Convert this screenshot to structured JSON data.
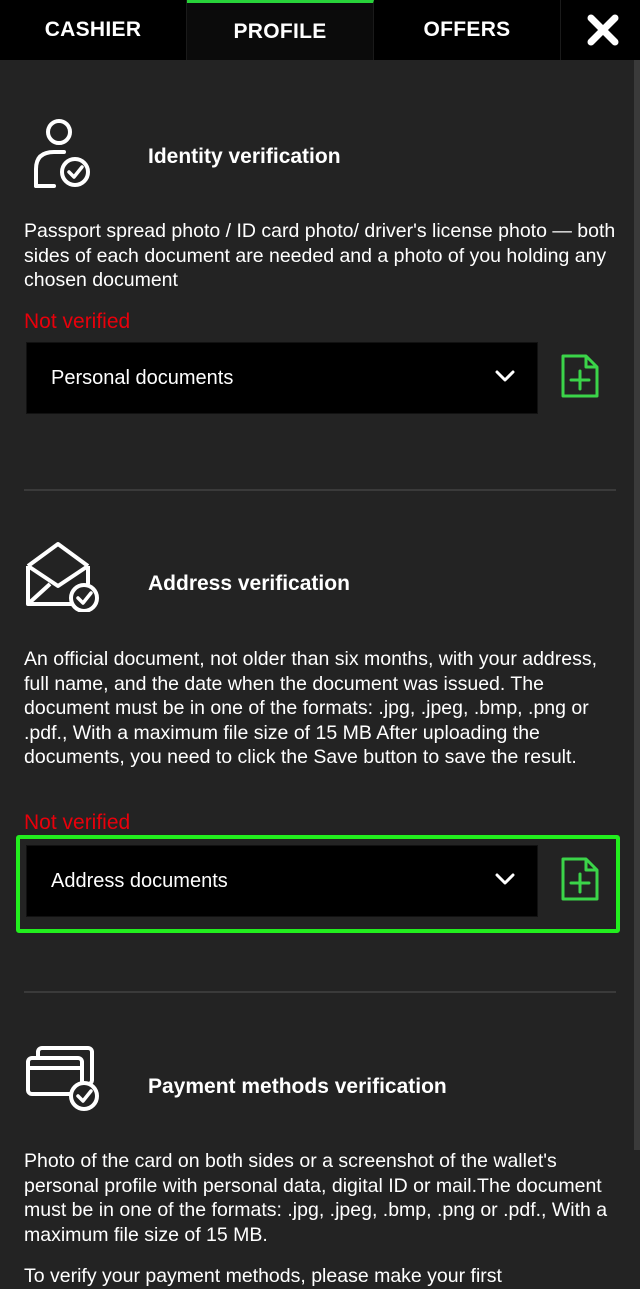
{
  "tabs": [
    {
      "label": "CASHIER",
      "active": false
    },
    {
      "label": "PROFILE",
      "active": true
    },
    {
      "label": "OFFERS",
      "active": false
    }
  ],
  "close_icon": "close-icon",
  "accent_color": "#28d33a",
  "status_color": "#e8000b",
  "sections": [
    {
      "icon": "user-check-icon",
      "title": "Identity verification",
      "description": "Passport spread photo / ID card photo/ driver's license photo — both sides of each document are needed and a photo of you holding any chosen document",
      "status": "Not verified",
      "select_value": "Personal documents",
      "upload_icon": "file-plus-icon"
    },
    {
      "icon": "envelope-check-icon",
      "title": "Address verification",
      "description": "An official document, not older than six months, with your address, full name, and the date when the document was issued. The document must be in one of the formats: .jpg, .jpeg, .bmp, .png or .pdf., With a maximum file size of 15 MB After uploading the documents, you need to click the Save button to save the result.",
      "status": "Not verified",
      "select_value": "Address documents",
      "upload_icon": "file-plus-icon"
    },
    {
      "icon": "cards-check-icon",
      "title": "Payment methods verification",
      "description": "Photo of the card on both sides or a screenshot of the wallet's personal profile with personal data, digital ID or mail.The document must be in one of the formats: .jpg, .jpeg, .bmp, .png or .pdf., With a maximum file size of 15 MB.",
      "extra_text": "To verify your payment methods, please make your first"
    }
  ]
}
